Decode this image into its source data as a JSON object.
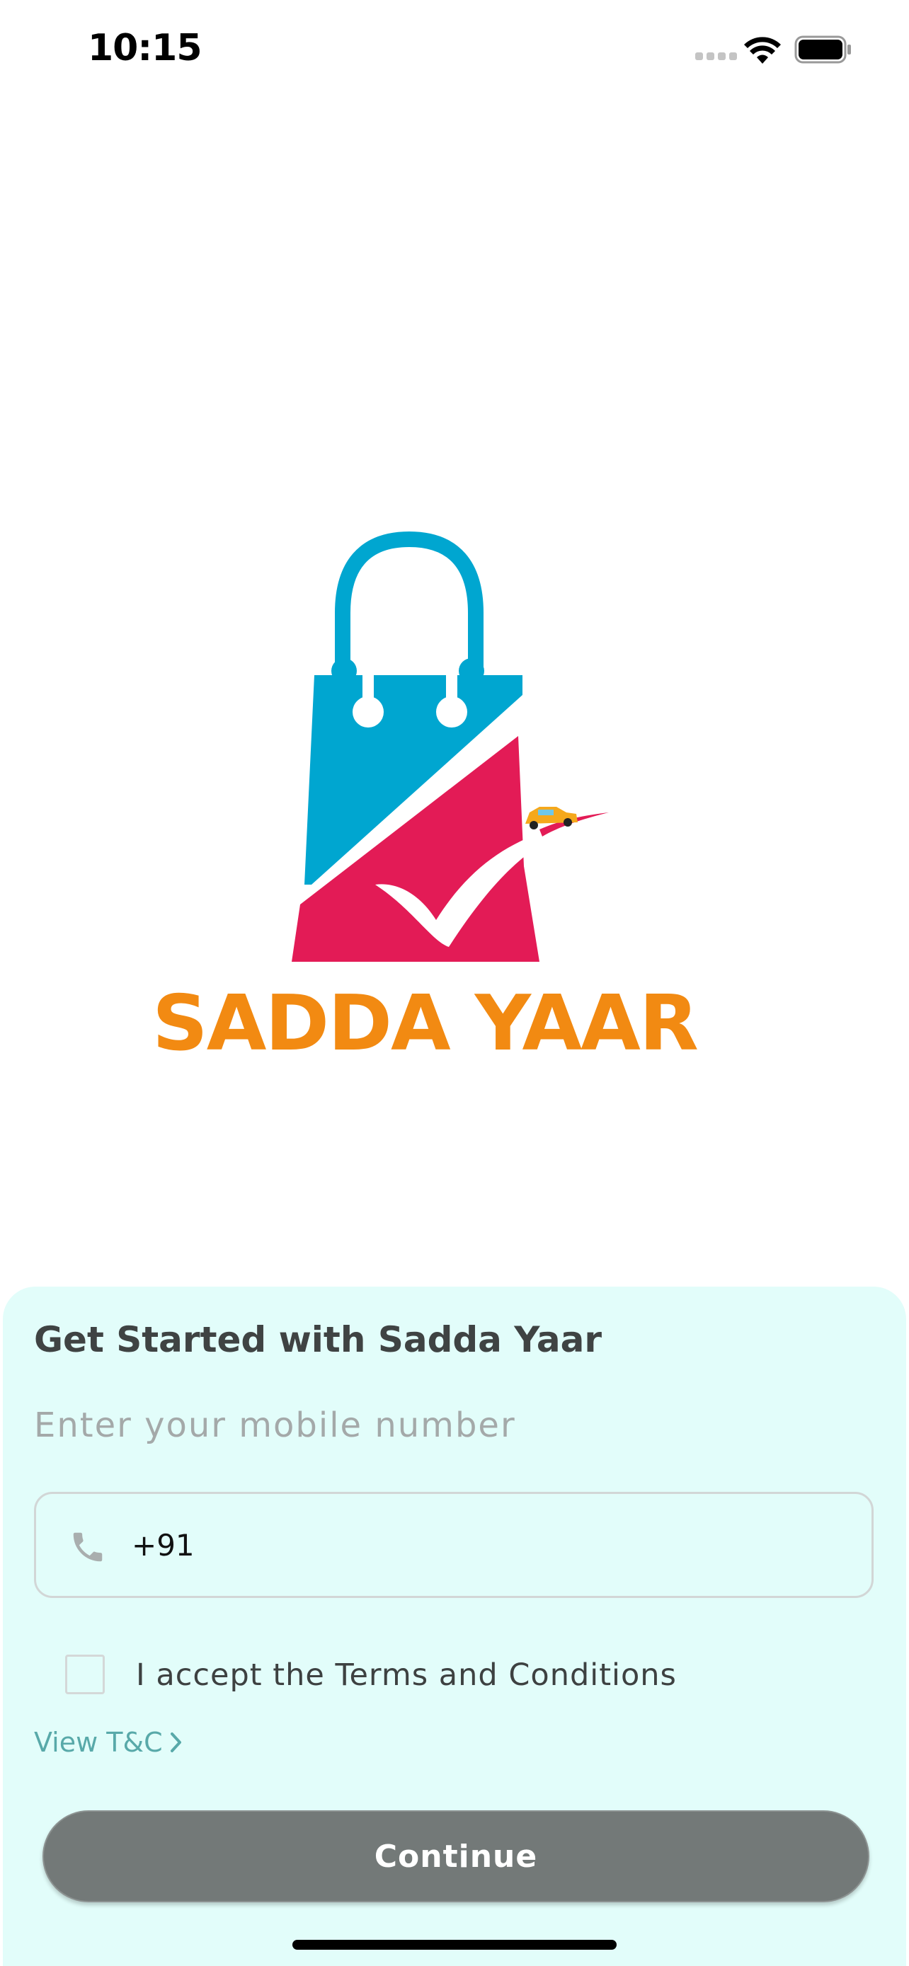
{
  "status_bar": {
    "time": "10:15",
    "icons": [
      "signal-icon",
      "wifi-icon",
      "battery-icon"
    ]
  },
  "logo": {
    "brand_text": "SADDA YAAR",
    "colors": {
      "bag_blue": "#00a6d0",
      "bag_pink": "#e31b56",
      "brand_orange": "#f28a12",
      "car_yellow": "#f5a81c"
    }
  },
  "sheet": {
    "title": "Get Started with Sadda Yaar",
    "subtitle": "Enter your mobile number",
    "phone": {
      "country_code": "+91",
      "value": "",
      "placeholder": ""
    },
    "terms": {
      "checked": false,
      "label": "I accept the Terms and Conditions",
      "view_link": "View T&C"
    },
    "continue_label": "Continue",
    "colors": {
      "background": "#e2fdfa",
      "button": "#737978",
      "link": "#58a9a9"
    }
  }
}
